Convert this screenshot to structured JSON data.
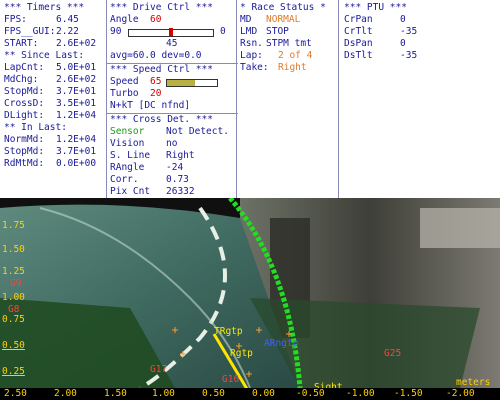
{
  "timers": {
    "header": "*** Timers ***",
    "fps": {
      "label": "FPS:",
      "value": "6.45"
    },
    "fps_gui": {
      "label": "FPS__GUI:",
      "value": "2.22"
    },
    "start": {
      "label": "START:",
      "value": "2.6E+02"
    },
    "since_last_header": "** Since Last:",
    "lap_cnt": {
      "label": "LapCnt:",
      "value": "5.0E+01"
    },
    "md_chg": {
      "label": "MdChg:",
      "value": "2.6E+02"
    },
    "stop_md": {
      "label": "StopMd:",
      "value": "3.7E+01"
    },
    "cross_d": {
      "label": "CrossD:",
      "value": "3.5E+01"
    },
    "d_light": {
      "label": "DLight:",
      "value": "1.2E+04"
    },
    "in_last_header": "** In Last:",
    "norm_md": {
      "label": "NormMd:",
      "value": "1.2E+04"
    },
    "stop_md2": {
      "label": "StopMd:",
      "value": "3.7E+01"
    },
    "rd_mt_md": {
      "label": "RdMtMd:",
      "value": "0.0E+00"
    }
  },
  "drive": {
    "header": "***  Drive Ctrl  ***",
    "angle_label": "Angle",
    "angle_value": "60",
    "slider_left": "90",
    "slider_right": "0",
    "slider_level": 0.5,
    "slider_mid": "45",
    "avg_line": "avg=60.0  dev=0.0",
    "speed_header": "***  Speed Ctrl  ***",
    "speed_label": "Speed",
    "speed_value": "65",
    "speed_level": 0.55,
    "turbo_label": "Turbo",
    "turbo_value": "20",
    "nkt_line": "N+kT [DC nfnd]",
    "cross_header": "*** Cross Det. ***",
    "sensor_label": "Sensor",
    "sensor_value": "Not Detect.",
    "vision_label": "Vision",
    "vision_value": "no",
    "sline_label": "S. Line",
    "sline_value": "Right",
    "rangle_label": "RAngle",
    "rangle_value": "-24",
    "corr_label": "Corr.",
    "corr_value": "0.73",
    "pix_label": "Pix Cnt",
    "pix_value": "26332"
  },
  "race": {
    "header": "* Race Status *",
    "md_label": "MD",
    "md_value": "NORMAL",
    "lmd_label": "LMD",
    "lmd_value": "STOP",
    "rsn_label": "Rsn.",
    "rsn_value": "STPM tmt",
    "lap_label": "Lap:",
    "lap_value": "2 of 4",
    "take_label": "Take:",
    "take_value": "Right"
  },
  "ptu": {
    "header": "*** PTU ***",
    "cr_pan": {
      "label": "CrPan",
      "value": "0"
    },
    "cr_tilt": {
      "label": "CrTlt",
      "value": "-35"
    },
    "ds_pan": {
      "label": "DsPan",
      "value": "0"
    },
    "ds_tilt": {
      "label": "DsTlt",
      "value": "-35"
    }
  },
  "camera": {
    "y_ticks": [
      "1.75",
      "1.50",
      "1.25",
      "1.00",
      "0.75",
      "0.50",
      "0.25"
    ],
    "x_ticks": [
      "2.50",
      "2.00",
      "1.50",
      "1.00",
      "0.50",
      "0.00",
      "-0.50",
      "-1.00",
      "-1.50",
      "-2.00"
    ],
    "units": "meters",
    "annotations": {
      "g9": "G9",
      "g8": "G8",
      "trgtp": "TRgtp",
      "rgtp": "Rgtp",
      "arngtp": "ARngtp",
      "g25": "G25",
      "g17": "G17",
      "g16": "G16",
      "sight": "Sight"
    }
  },
  "colors": {
    "panel_text": "#1a1a9a",
    "accent_red": "#d40000",
    "accent_orange": "#e07a2c",
    "accent_green": "#1e9a1e",
    "axis_text": "#ffd000",
    "edge_line": "#22dd22"
  }
}
